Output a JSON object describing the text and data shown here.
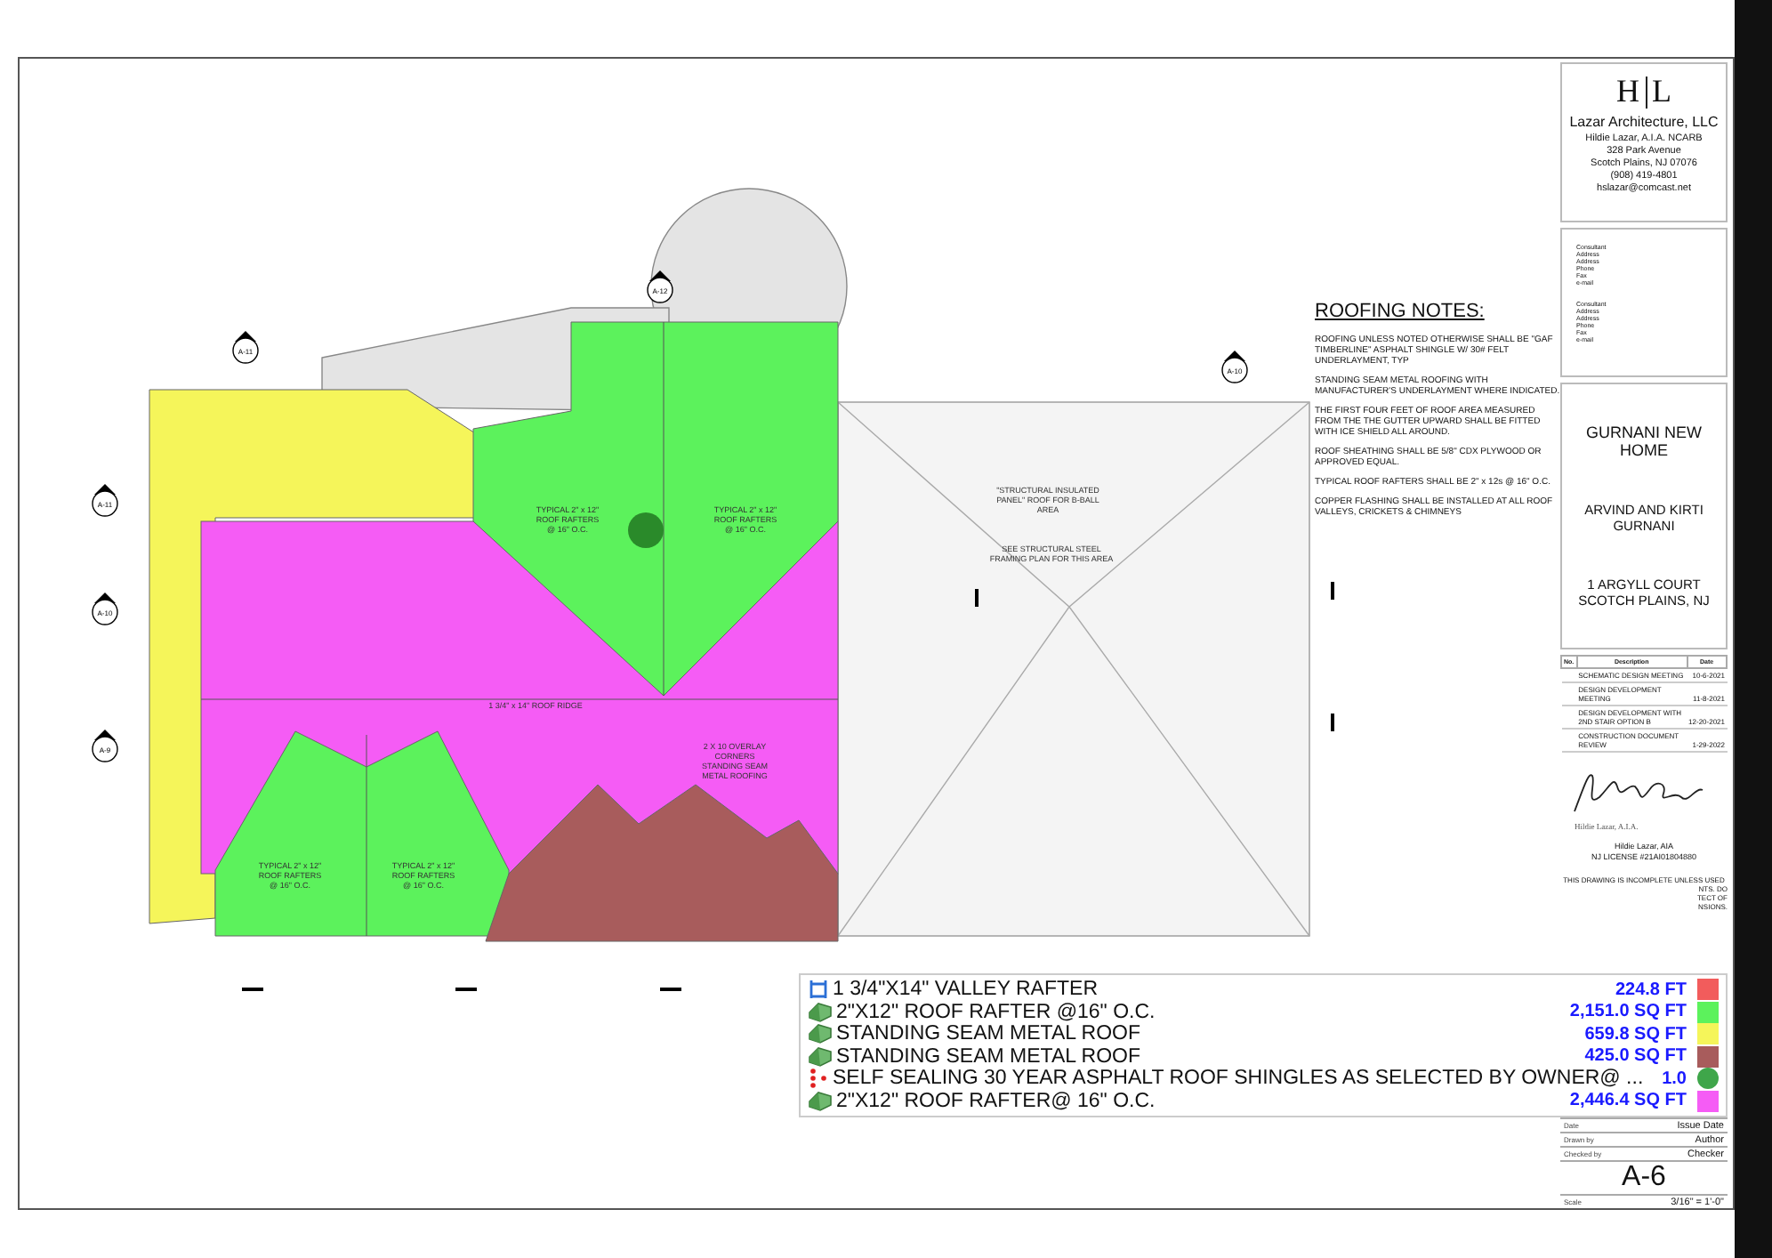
{
  "firm": {
    "logo_left": "H",
    "logo_right": "L",
    "name": "Lazar Architecture, LLC",
    "lines": [
      "Hildie Lazar, A.I.A. NCARB",
      "328 Park Avenue",
      "Scotch Plains, NJ 07076",
      "(908) 419-4801",
      "hslazar@comcast.net"
    ]
  },
  "consultants": [
    [
      "Consultant",
      "Address",
      "Address",
      "Phone",
      "Fax",
      "e-mail"
    ],
    [
      "Consultant",
      "Address",
      "Address",
      "Phone",
      "Fax",
      "e-mail"
    ]
  ],
  "project": {
    "title": "GURNANI NEW HOME",
    "client": "ARVIND AND KIRTI GURNANI",
    "address": "1 ARGYLL COURT SCOTCH PLAINS, NJ"
  },
  "revisions": {
    "columns": [
      "No.",
      "Description",
      "Date"
    ],
    "rows": [
      {
        "description": "SCHEMATIC DESIGN MEETING",
        "date": "10-6-2021"
      },
      {
        "description": "DESIGN DEVELOPMENT MEETING",
        "date": "11-8-2021"
      },
      {
        "description": "DESIGN DEVELOPMENT WITH 2ND STAIR OPTION B",
        "date": "12-20-2021"
      },
      {
        "description": "CONSTRUCTION DOCUMENT REVIEW",
        "date": "1-29-2022"
      }
    ]
  },
  "stamp": {
    "printed_name": "Hildie Lazar, A.I.A.",
    "name": "Hildie Lazar, AIA",
    "license": "NJ LICENSE #21AI01804880"
  },
  "disclaimer": {
    "first_line": "THIS DRAWING IS INCOMPLETE UNLESS USED",
    "fragments": [
      "NTS. DO",
      "TECT OF",
      "NSIONS."
    ]
  },
  "sheet_info": [
    {
      "label": "Date",
      "value": "Issue Date"
    },
    {
      "label": "Drawn by",
      "value": "Author"
    },
    {
      "label": "Checked by",
      "value": "Checker"
    }
  ],
  "sheet_number": "A-6",
  "scale": {
    "label": "Scale",
    "value": "3/16\" = 1'-0\""
  },
  "roofing_notes": {
    "title": "ROOFING NOTES:",
    "notes": [
      "ROOFING UNLESS NOTED OTHERWISE SHALL BE \"GAF TIMBERLINE\" ASPHALT SHINGLE W/ 30# FELT UNDERLAYMENT, TYP",
      "STANDING SEAM METAL ROOFING WITH MANUFACTURER'S UNDERLAYMENT WHERE INDICATED.",
      "THE FIRST FOUR FEET OF ROOF AREA MEASURED FROM THE THE GUTTER UPWARD SHALL BE FITTED WITH ICE SHIELD ALL AROUND.",
      "ROOF SHEATHING SHALL BE 5/8\" CDX PLYWOOD OR APPROVED EQUAL.",
      "TYPICAL ROOF RAFTERS SHALL BE 2\" x 12s @ 16\" O.C.",
      "COPPER FLASHING SHALL BE INSTALLED AT ALL ROOF VALLEYS, CRICKETS & CHIMNEYS"
    ]
  },
  "plan_labels": [
    {
      "lines": [
        "TYPICAL 2\" x 12\"",
        "ROOF RAFTERS",
        "@ 16\" O.C."
      ]
    },
    {
      "lines": [
        "TYPICAL 2\" x 12\"",
        "ROOF RAFTERS",
        "@ 16\" O.C."
      ]
    },
    {
      "lines": [
        "TYPICAL 2\" x 12\"",
        "ROOF RAFTERS",
        "@ 16\" O.C."
      ]
    },
    {
      "lines": [
        "TYPICAL 2\" x 12\"",
        "ROOF RAFTERS",
        "@ 16\" O.C."
      ]
    },
    {
      "lines": [
        "1 3/4\" x 14\" ROOF RIDGE"
      ]
    },
    {
      "lines": [
        "2 X 10 OVERLAY",
        "CORNERS",
        "STANDING SEAM",
        "METAL ROOFING"
      ]
    },
    {
      "lines": [
        "\"STRUCTURAL INSULATED",
        "PANEL\" ROOF FOR B-BALL",
        "AREA"
      ]
    },
    {
      "lines": [
        "SEE STRUCTURAL STEEL",
        "FRAMING PLAN FOR THIS AREA"
      ]
    }
  ],
  "section_markers": [
    {
      "sheet": "A-11"
    },
    {
      "sheet": "A-12"
    },
    {
      "sheet": "A-10"
    },
    {
      "sheet": "A-11"
    },
    {
      "sheet": "A-10"
    },
    {
      "sheet": "A-9"
    }
  ],
  "legend": [
    {
      "kind": "line",
      "label": "1 3/4\"X14\"  VALLEY RAFTER",
      "quantity": "224.8 FT",
      "color": "#f25c5c"
    },
    {
      "kind": "roof",
      "label": "2\"X12\" ROOF RAFTER @16\" O.C.",
      "quantity": "2,151.0 SQ FT",
      "color": "#5cf25c"
    },
    {
      "kind": "roof",
      "label": "STANDING SEAM METAL ROOF",
      "quantity": "659.8 SQ FT",
      "color": "#f5f55a"
    },
    {
      "kind": "roof",
      "label": "STANDING SEAM METAL ROOF",
      "quantity": "425.0 SQ FT",
      "color": "#a85c5c"
    },
    {
      "kind": "dots",
      "label": "SELF SEALING 30 YEAR ASPHALT ROOF SHINGLES AS SELECTED BY OWNER@ ...",
      "quantity": "1.0",
      "color": "#3fa64a"
    },
    {
      "kind": "roof",
      "label": "2\"X12\" ROOF RAFTER@ 16\" O.C.",
      "quantity": "2,446.4 SQ FT",
      "color": "#f55cf5"
    }
  ]
}
